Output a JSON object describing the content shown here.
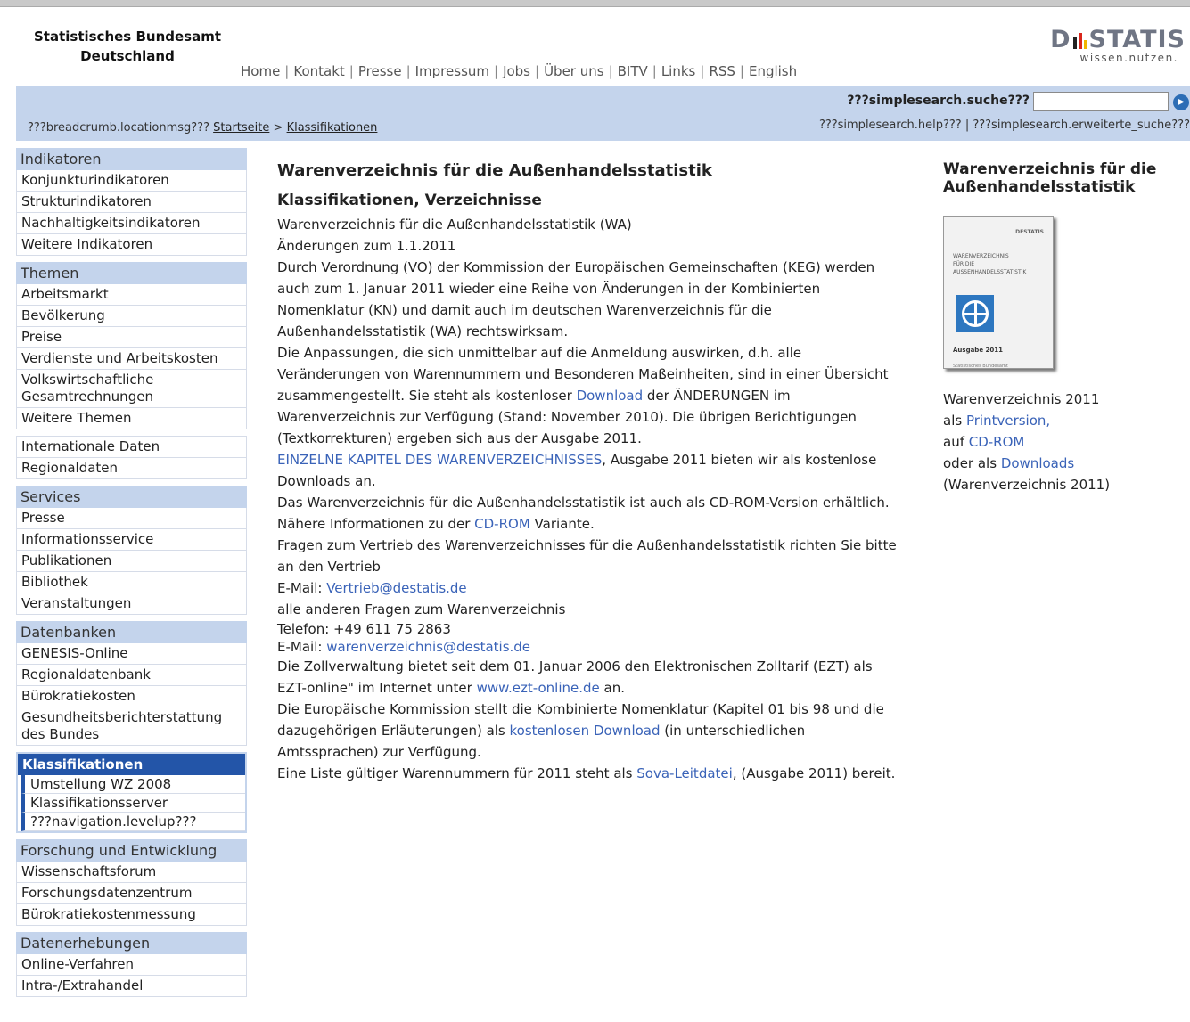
{
  "header": {
    "org_line1": "Statistisches Bundesamt",
    "org_line2": "Deutschland",
    "topnav": [
      "Home",
      "Kontakt",
      "Presse",
      "Impressum",
      "Jobs",
      "Über uns",
      "BITV",
      "Links",
      "RSS",
      "English"
    ],
    "logo_left": "D",
    "logo_right": "STATIS",
    "logo_tagline": "wissen.nutzen."
  },
  "searchbar": {
    "label": "???simplesearch.suche???",
    "input_value": "",
    "help_link": "???simplesearch.help???",
    "help_sep": "|",
    "advanced_link": "???simplesearch.erweiterte_suche???"
  },
  "breadcrumb": {
    "prefix": "???breadcrumb.locationmsg???",
    "home": "Startseite",
    "sep": ">",
    "current": "Klassifikationen"
  },
  "sidebar": {
    "indikatoren": {
      "head": "Indikatoren",
      "items": [
        "Konjunkturindikatoren",
        "Strukturindikatoren",
        "Nachhaltigkeitsindikatoren",
        "Weitere Indikatoren"
      ]
    },
    "themen": {
      "head": "Themen",
      "items": [
        "Arbeitsmarkt",
        "Bevölkerung",
        "Preise",
        "Verdienste und Arbeitskosten",
        "Volkswirtschaftliche Gesamtrechnungen",
        "Weitere Themen"
      ]
    },
    "daten": {
      "items": [
        "Internationale Daten",
        "Regionaldaten"
      ]
    },
    "services": {
      "head": "Services",
      "items": [
        "Presse",
        "Informationsservice",
        "Publikationen",
        "Bibliothek",
        "Veranstaltungen"
      ]
    },
    "datenbanken": {
      "head": "Datenbanken",
      "items": [
        "GENESIS-Online",
        "Regionaldatenbank",
        "Bürokratiekosten",
        "Gesundheitsberichterstattung des Bundes"
      ]
    },
    "klassifikationen": {
      "head": "Klassifikationen",
      "items": [
        "Umstellung WZ 2008",
        "Klassifikationsserver",
        "???navigation.levelup???"
      ]
    },
    "forschung": {
      "head": "Forschung und Entwicklung",
      "items": [
        "Wissenschaftsforum",
        "Forschungsdatenzentrum",
        "Bürokratiekostenmessung"
      ]
    },
    "erhebungen": {
      "head": "Datenerhebungen",
      "items": [
        "Online-Verfahren",
        "Intra-/Extrahandel"
      ]
    }
  },
  "main": {
    "title": "Warenverzeichnis für die Außenhandelsstatistik",
    "subtitle": "Klassifikationen, Verzeichnisse",
    "p1_line1": "Warenverzeichnis für die Außenhandelsstatistik (WA)",
    "p1_line2": "Änderungen zum 1.1.2011",
    "p1_text_a": "Durch Verordnung (VO) der Kommission der Europäischen Gemeinschaften (KEG) werden auch zum 1. Januar 2011 wieder eine Reihe von Änderungen in der Kombinierten Nomenklatur (KN) und damit auch im deutschen Warenverzeichnis für die Außenhandelsstatistik (WA) rechtswirksam.",
    "p1_text_b": "Die Anpassungen, die sich unmittelbar auf die Anmeldung auswirken, d.h. alle Veränderungen von Warennummern und Besonderen Maßeinheiten, sind in einer Übersicht zusammengestellt. Sie steht als kostenloser ",
    "p1_link_download": "Download",
    "p1_text_c": " der ÄNDERUNGEN im Warenverzeichnis zur Verfügung (Stand: November 2010). Die übrigen Berichtigungen (Textkorrekturen) ergeben sich aus der Ausgabe 2011.",
    "p2_link": "EINZELNE KAPITEL DES WARENVERZEICHNISSES",
    "p2_text": ", Ausgabe 2011 bieten wir als kostenlose Downloads an.",
    "p3_text_a": "Das Warenverzeichnis für die Außenhandelsstatistik ist auch als CD-ROM-Version erhältlich. Nähere Informationen zu der ",
    "p3_link": "CD-ROM",
    "p3_text_b": " Variante.",
    "p4_text": "Fragen zum Vertrieb des Warenverzeichnisses für die Außenhandelsstatistik richten Sie bitte an den Vertrieb",
    "email1_label": "E-Mail: ",
    "email1": "Vertrieb@destatis.de",
    "p5_text": "alle anderen Fragen zum Warenverzeichnis",
    "phone": "Telefon:  +49 611 75 2863",
    "email2_label": "E-Mail: ",
    "email2": "warenverzeichnis@destatis.de",
    "p6_text_a": "Die Zollverwaltung bietet seit dem 01. Januar 2006 den Elektronischen Zolltarif (EZT) als EZT-online\" im Internet unter ",
    "p6_link": "www.ezt-online.de",
    "p6_text_b": " an.",
    "p7_text_a": "Die Europäische Kommission stellt die Kombinierte Nomenklatur (Kapitel 01 bis 98 und die dazugehörigen Erläuterungen) als ",
    "p7_link": "kostenlosen Download",
    "p7_text_b": " (in unterschiedlichen Amtssprachen) zur Verfügung.",
    "p8_text_a": "Eine Liste gültiger Warennummern für 2011 steht als ",
    "p8_link": "Sova-Leitdatei",
    "p8_text_b": ", (Ausgabe 2011) bereit."
  },
  "right": {
    "title": "Warenverzeichnis für die Außenhandelsstatistik",
    "cover_logo": "DESTATIS",
    "cover_title": "WARENVERZEICHNIS\nFÜR DIE\nAUSSENHANDELSSTATISTIK",
    "cover_edition": "Ausgabe 2011",
    "cover_publisher": "Statistisches Bundesamt",
    "line1": "Warenverzeichnis 2011",
    "line2_text": "als ",
    "line2_link": "Printversion,",
    "line3_text": "auf ",
    "line3_link": "CD-ROM",
    "line4_text": "oder als ",
    "line4_link": "Downloads",
    "line5": "(Warenverzeichnis 2011)"
  },
  "colors": {
    "bar_blue": "#c4d4ec",
    "active_blue": "#2355a8",
    "link_blue": "#3a63b8"
  }
}
